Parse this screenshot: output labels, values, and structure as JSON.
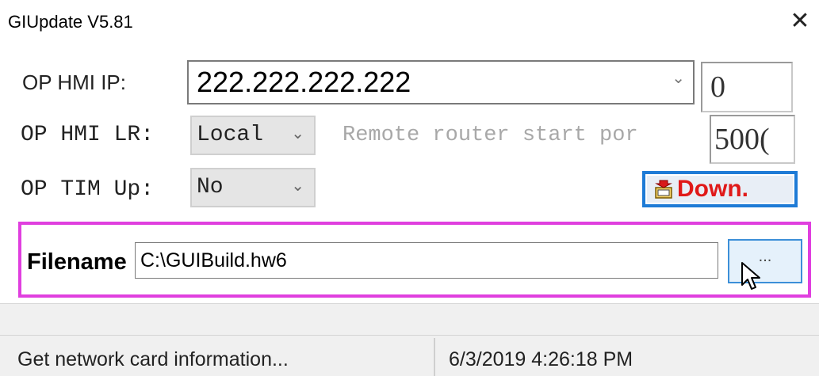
{
  "window": {
    "title": "GIUpdate V5.81",
    "close_glyph": "✕"
  },
  "form": {
    "ip_label": "OP HMI IP:",
    "ip_value": "222.222.222.222",
    "ip_index": "0",
    "lr_label": "OP HMI LR:",
    "lr_value": "Local",
    "remote_port_label": "Remote router start por",
    "remote_port_value": "500(",
    "tim_label": "OP TIM Up:",
    "tim_value": "No",
    "down_label": "Down.",
    "chevron_glyph": "⌄"
  },
  "file": {
    "label": "Filename",
    "value": "C:\\GUIBuild.hw6",
    "browse_label": "..."
  },
  "status": {
    "message": "Get network card information...",
    "datetime": "6/3/2019  4:26:18 PM"
  },
  "colors": {
    "highlight_border": "#e03fdf",
    "down_text": "#e01919",
    "down_border": "#1e7bd6"
  }
}
